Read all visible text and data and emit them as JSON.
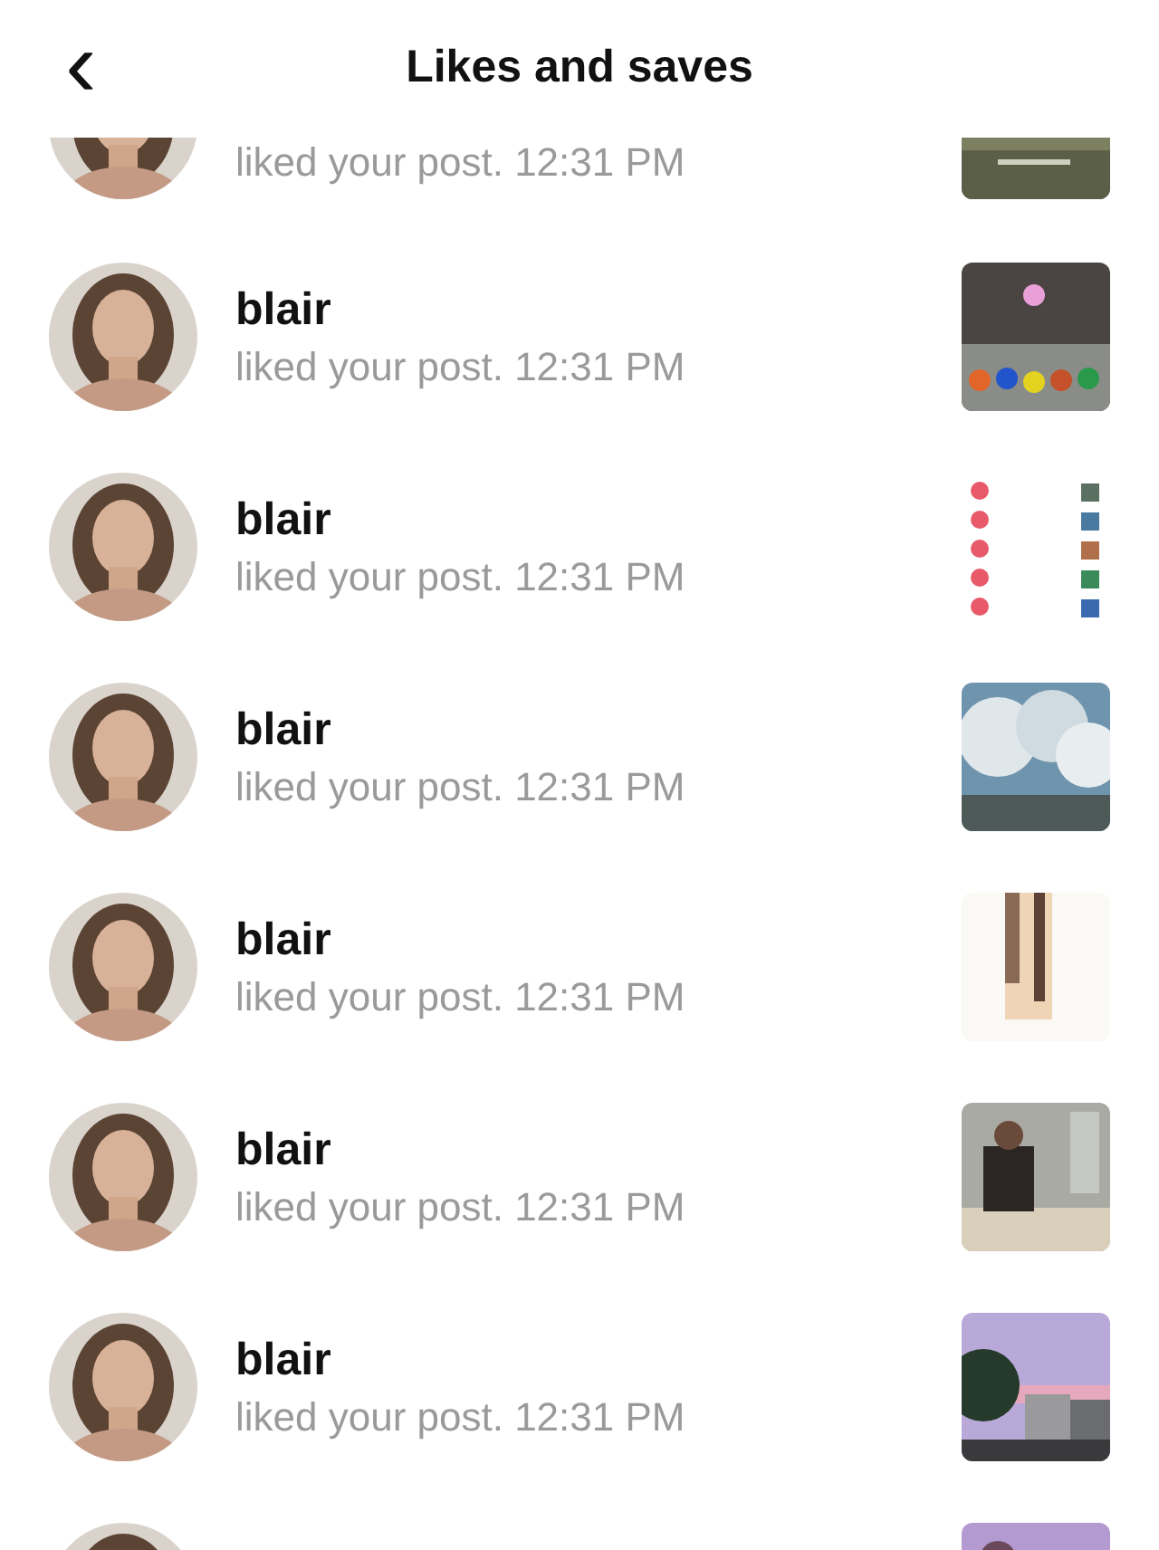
{
  "header": {
    "back_icon": "‹",
    "title": "Likes and saves"
  },
  "notifications": [
    {
      "text": "liked your post. 12:31 PM",
      "thumbnail": {
        "kind": "picture"
      }
    },
    {
      "name": "blair",
      "text": "liked your post. 12:31 PM",
      "thumbnail": {
        "kind": "picture"
      }
    },
    {
      "name": "blair",
      "text": "liked your post. 12:31 PM",
      "thumbnail": {
        "kind": "picture"
      }
    },
    {
      "name": "blair",
      "text": "liked your post. 12:31 PM",
      "thumbnail": {
        "kind": "picture"
      }
    },
    {
      "name": "blair",
      "text": "liked your post. 12:31 PM",
      "thumbnail": {
        "kind": "picture"
      }
    },
    {
      "name": "blair",
      "text": "liked your post. 12:31 PM",
      "thumbnail": {
        "kind": "picture"
      }
    },
    {
      "name": "blair",
      "text": "liked your post. 12:31 PM",
      "thumbnail": {
        "kind": "picture"
      }
    },
    {
      "thumbnail": {
        "kind": "picture"
      }
    }
  ]
}
